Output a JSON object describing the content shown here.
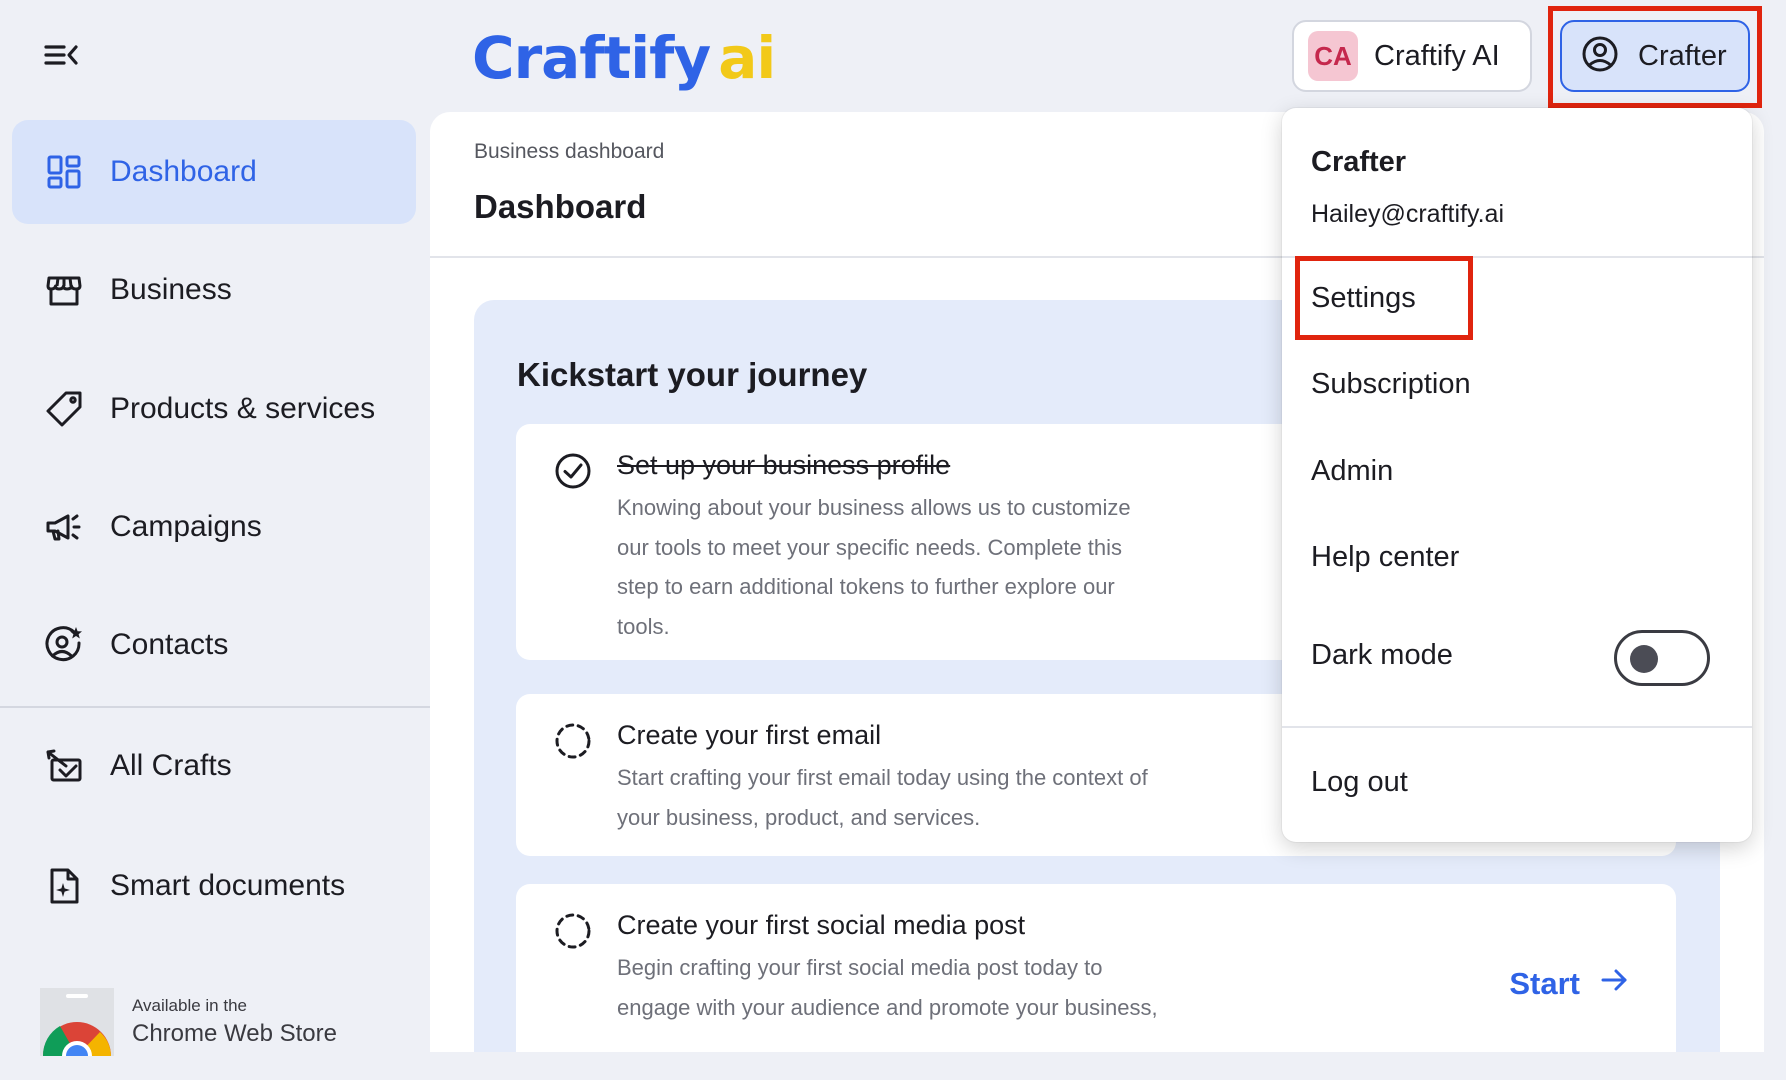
{
  "sidebar": {
    "items": [
      {
        "label": "Dashboard",
        "icon": "dashboard-icon",
        "active": true
      },
      {
        "label": "Business",
        "icon": "storefront-icon"
      },
      {
        "label": "Products & services",
        "icon": "tag-icon"
      },
      {
        "label": "Campaigns",
        "icon": "megaphone-icon"
      },
      {
        "label": "Contacts",
        "icon": "contact-star-icon"
      },
      {
        "label": "All Crafts",
        "icon": "crafts-icon"
      },
      {
        "label": "Smart documents",
        "icon": "smart-document-icon"
      }
    ],
    "chrome_store": {
      "line1": "Available in the",
      "line2": "Chrome Web Store"
    }
  },
  "header": {
    "logo_main": "Craftify",
    "logo_suffix": "ai",
    "workspace": {
      "initials": "CA",
      "name": "Craftify AI"
    },
    "user_button": {
      "label": "Crafter"
    }
  },
  "main": {
    "breadcrumb": "Business dashboard",
    "title": "Dashboard",
    "journey": {
      "title": "Kickstart your journey",
      "steps": [
        {
          "title": "Set up your business profile",
          "done": true,
          "lines": [
            "Knowing about your business allows us to customize",
            "our tools to meet your specific needs. Complete this",
            "step to earn additional tokens to further explore our",
            "tools."
          ]
        },
        {
          "title": "Create your first email",
          "done": false,
          "lines": [
            "Start crafting your first email today using the context of",
            "your business, product, and services."
          ]
        },
        {
          "title": "Create your first social media post",
          "done": false,
          "lines": [
            "Begin crafting your first social media post today to",
            "engage with your audience and promote your business,"
          ],
          "action": "Start"
        }
      ]
    }
  },
  "dropdown": {
    "name": "Crafter",
    "email": "Hailey@craftify.ai",
    "items": {
      "settings": "Settings",
      "subscription": "Subscription",
      "admin": "Admin",
      "help": "Help center",
      "dark_mode": "Dark mode",
      "logout": "Log out"
    },
    "dark_mode_on": false
  },
  "colors": {
    "accent": "#2f63e6",
    "logo_ai": "#f2c919",
    "highlight": "#e0240e",
    "active_bg": "#d8e3fa"
  }
}
